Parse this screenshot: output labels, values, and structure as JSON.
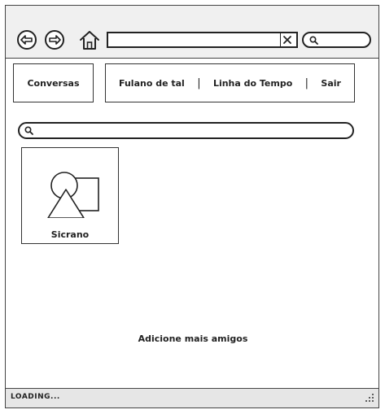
{
  "browser": {
    "back_icon": "arrow-left-circle-icon",
    "forward_icon": "arrow-right-circle-icon",
    "home_icon": "home-icon",
    "url_value": "",
    "clear_icon": "close-icon",
    "search_icon": "search-icon",
    "search_value": ""
  },
  "nav": {
    "conversas": "Conversas",
    "fulano": "Fulano de tal",
    "separator": "|",
    "timeline": "Linha do Tempo",
    "sair": "Sair"
  },
  "search": {
    "value": "",
    "icon": "search-icon"
  },
  "friends": [
    {
      "name": "Sicrano",
      "image": "image-placeholder-icon"
    }
  ],
  "add_friends_label": "Adicione mais amigos",
  "status": {
    "text": "LOADING...",
    "grip_icon": "resize-grip-icon"
  },
  "colors": {
    "chrome": "#f0f0f0",
    "statusbar": "#e6e6e6",
    "stroke": "#222222"
  }
}
